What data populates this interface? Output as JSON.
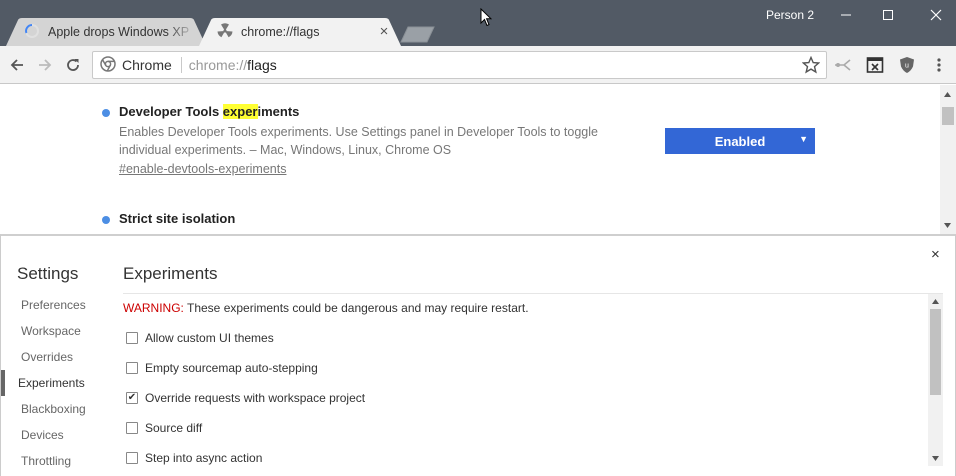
{
  "tabs": [
    {
      "title": "Apple drops Windows XP",
      "active": false
    },
    {
      "title": "chrome://flags",
      "active": true
    }
  ],
  "window": {
    "profile": "Person 2"
  },
  "omnibox": {
    "chip_label": "Chrome",
    "url_scheme": "chrome://",
    "url_host": "flags"
  },
  "flags": [
    {
      "title_before": "Developer Tools ",
      "title_match": "exper",
      "title_after": "iments",
      "description": "Enables Developer Tools experiments. Use Settings panel in Developer Tools to toggle individual experiments. – Mac, Windows, Linux, Chrome OS",
      "link": "#enable-devtools-experiments",
      "select_value": "Enabled"
    },
    {
      "title": "Strict site isolation"
    }
  ],
  "devtools": {
    "settings_title": "Settings",
    "nav": [
      "Preferences",
      "Workspace",
      "Overrides",
      "Experiments",
      "Blackboxing",
      "Devices",
      "Throttling"
    ],
    "active_nav": "Experiments",
    "panel_title": "Experiments",
    "warning_label": "WARNING:",
    "warning_text": " These experiments could be dangerous and may require restart.",
    "experiments": [
      {
        "label": "Allow custom UI themes",
        "checked": false,
        "mark": ""
      },
      {
        "label": "Empty sourcemap auto-stepping",
        "checked": false,
        "mark": ""
      },
      {
        "label": "Override requests with workspace project",
        "checked": true,
        "mark": "✔"
      },
      {
        "label": "Source diff",
        "checked": false,
        "mark": ""
      },
      {
        "label": "Step into async action",
        "checked": false,
        "mark": ""
      }
    ]
  },
  "colors": {
    "titlebar": "#525a65",
    "accent_blue": "#3367d6",
    "flag_dot": "#4c8ee4",
    "highlight": "#ffff33",
    "warning_red": "#cc0000"
  },
  "icons": [
    "back-arrow-icon",
    "forward-arrow-icon",
    "reload-icon",
    "chrome-logo-icon",
    "star-icon",
    "extension-icons",
    "menu-icon"
  ]
}
